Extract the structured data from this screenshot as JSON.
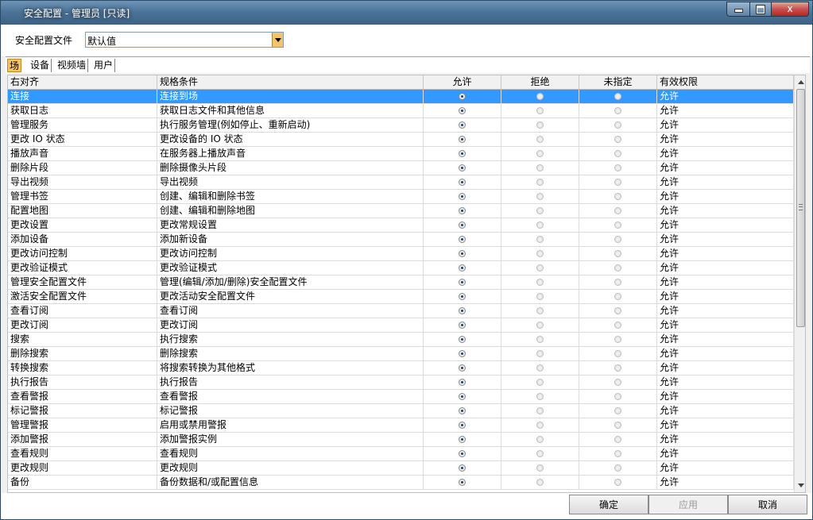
{
  "window": {
    "title": "安全配置 - 管理员 [只读]",
    "min_glyph": "",
    "max_glyph": "",
    "close_glyph": "x"
  },
  "profile": {
    "label": "安全配置文件",
    "value": "默认值"
  },
  "tabs": [
    {
      "label": "场",
      "active": true
    },
    {
      "label": "设备",
      "active": false
    },
    {
      "label": "视频墙",
      "active": false
    },
    {
      "label": "用户",
      "active": false
    }
  ],
  "columns": {
    "name": "右对齐",
    "condition": "规格条件",
    "allow": "允许",
    "deny": "拒绝",
    "unspecified": "未指定",
    "effective": "有效权限"
  },
  "rows": [
    {
      "name": "连接",
      "condition": "连接到场",
      "setting": "allow",
      "effective": "允许",
      "selected": true
    },
    {
      "name": "获取日志",
      "condition": "获取日志文件和其他信息",
      "setting": "allow",
      "effective": "允许"
    },
    {
      "name": "管理服务",
      "condition": "执行服务管理(例如停止、重新启动)",
      "setting": "allow",
      "effective": "允许"
    },
    {
      "name": "更改 IO 状态",
      "condition": "更改设备的 IO 状态",
      "setting": "allow",
      "effective": "允许"
    },
    {
      "name": "播放声音",
      "condition": "在服务器上播放声音",
      "setting": "allow",
      "effective": "允许"
    },
    {
      "name": "删除片段",
      "condition": "删除摄像头片段",
      "setting": "allow",
      "effective": "允许"
    },
    {
      "name": "导出视频",
      "condition": "导出视频",
      "setting": "allow",
      "effective": "允许"
    },
    {
      "name": "管理书签",
      "condition": "创建、编辑和删除书签",
      "setting": "allow",
      "effective": "允许"
    },
    {
      "name": "配置地图",
      "condition": "创建、编辑和删除地图",
      "setting": "allow",
      "effective": "允许"
    },
    {
      "name": "更改设置",
      "condition": "更改常规设置",
      "setting": "allow",
      "effective": "允许"
    },
    {
      "name": "添加设备",
      "condition": "添加新设备",
      "setting": "allow",
      "effective": "允许"
    },
    {
      "name": "更改访问控制",
      "condition": "更改访问控制",
      "setting": "allow",
      "effective": "允许"
    },
    {
      "name": "更改验证模式",
      "condition": "更改验证模式",
      "setting": "allow",
      "effective": "允许"
    },
    {
      "name": "管理安全配置文件",
      "condition": "管理(编辑/添加/删除)安全配置文件",
      "setting": "allow",
      "effective": "允许"
    },
    {
      "name": "激活安全配置文件",
      "condition": "更改活动安全配置文件",
      "setting": "allow",
      "effective": "允许"
    },
    {
      "name": "查看订阅",
      "condition": "查看订阅",
      "setting": "allow",
      "effective": "允许"
    },
    {
      "name": "更改订阅",
      "condition": "更改订阅",
      "setting": "allow",
      "effective": "允许"
    },
    {
      "name": "搜索",
      "condition": "执行搜索",
      "setting": "allow",
      "effective": "允许"
    },
    {
      "name": "删除搜索",
      "condition": "删除搜索",
      "setting": "allow",
      "effective": "允许"
    },
    {
      "name": "转换搜索",
      "condition": "将搜索转换为其他格式",
      "setting": "allow",
      "effective": "允许"
    },
    {
      "name": "执行报告",
      "condition": "执行报告",
      "setting": "allow",
      "effective": "允许"
    },
    {
      "name": "查看警报",
      "condition": "查看警报",
      "setting": "allow",
      "effective": "允许"
    },
    {
      "name": "标记警报",
      "condition": "标记警报",
      "setting": "allow",
      "effective": "允许"
    },
    {
      "name": "管理警报",
      "condition": "启用或禁用警报",
      "setting": "allow",
      "effective": "允许"
    },
    {
      "name": "添加警报",
      "condition": "添加警报实例",
      "setting": "allow",
      "effective": "允许"
    },
    {
      "name": "查看规则",
      "condition": "查看规则",
      "setting": "allow",
      "effective": "允许"
    },
    {
      "name": "更改规则",
      "condition": "更改规则",
      "setting": "allow",
      "effective": "允许"
    },
    {
      "name": "备份",
      "condition": "备份数据和/或配置信息",
      "setting": "allow",
      "effective": "允许"
    }
  ],
  "buttons": {
    "ok": "确定",
    "apply": "应用",
    "cancel": "取消"
  }
}
